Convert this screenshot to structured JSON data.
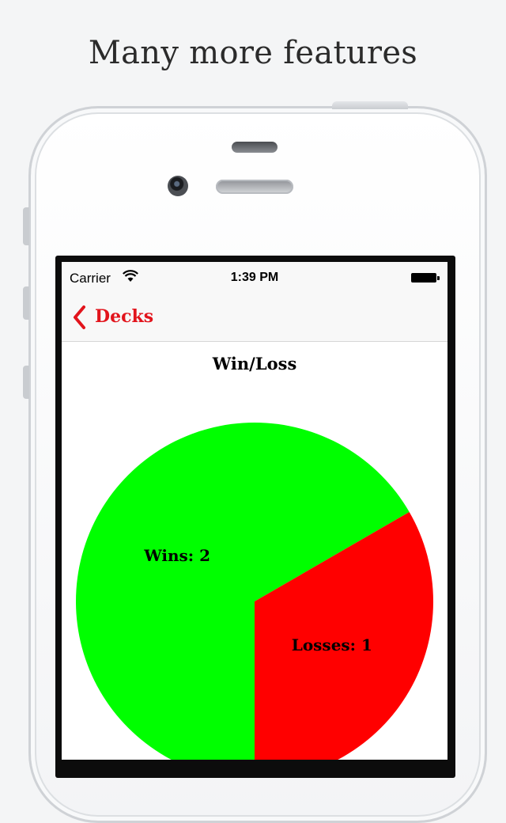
{
  "headline": "Many more features",
  "status": {
    "carrier": "Carrier",
    "time": "1:39 PM"
  },
  "nav": {
    "back_label": "Decks",
    "accent": "#e2141c"
  },
  "chart_data": {
    "type": "pie",
    "title": "Win/Loss",
    "slices": [
      {
        "name": "Wins",
        "value": 2,
        "label": "Wins: 2",
        "color": "#00ff00"
      },
      {
        "name": "Losses",
        "value": 1,
        "label": "Losses: 1",
        "color": "#ff0000"
      }
    ]
  }
}
